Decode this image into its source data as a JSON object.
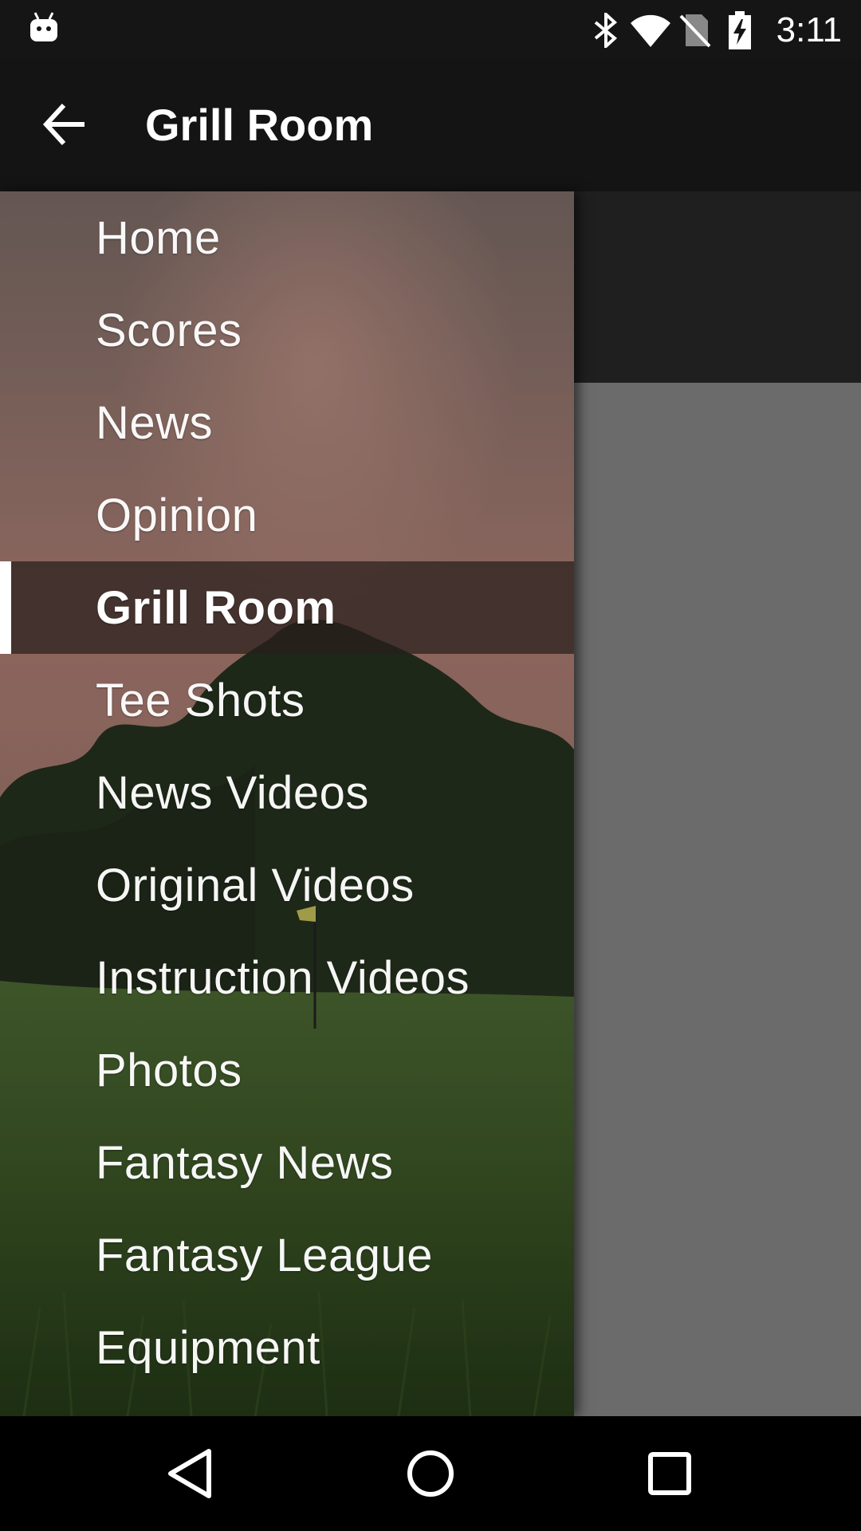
{
  "status_bar": {
    "time": "3:11",
    "icons": [
      "android-debug-icon",
      "bluetooth-icon",
      "wifi-icon",
      "no-sim-icon",
      "battery-charging-icon"
    ]
  },
  "toolbar": {
    "title": "Grill Room",
    "back_icon": "arrow-back-icon"
  },
  "drawer": {
    "items": [
      {
        "label": "Home",
        "selected": false
      },
      {
        "label": "Scores",
        "selected": false
      },
      {
        "label": "News",
        "selected": false
      },
      {
        "label": "Opinion",
        "selected": false
      },
      {
        "label": "Grill Room",
        "selected": true
      },
      {
        "label": "Tee Shots",
        "selected": false
      },
      {
        "label": "News Videos",
        "selected": false
      },
      {
        "label": "Original Videos",
        "selected": false
      },
      {
        "label": "Instruction Videos",
        "selected": false
      },
      {
        "label": "Photos",
        "selected": false
      },
      {
        "label": "Fantasy News",
        "selected": false
      },
      {
        "label": "Fantasy League",
        "selected": false
      },
      {
        "label": "Equipment",
        "selected": false
      }
    ]
  },
  "nav_bar": {
    "icons": [
      "back-triangle-icon",
      "home-circle-icon",
      "recents-square-icon"
    ]
  }
}
